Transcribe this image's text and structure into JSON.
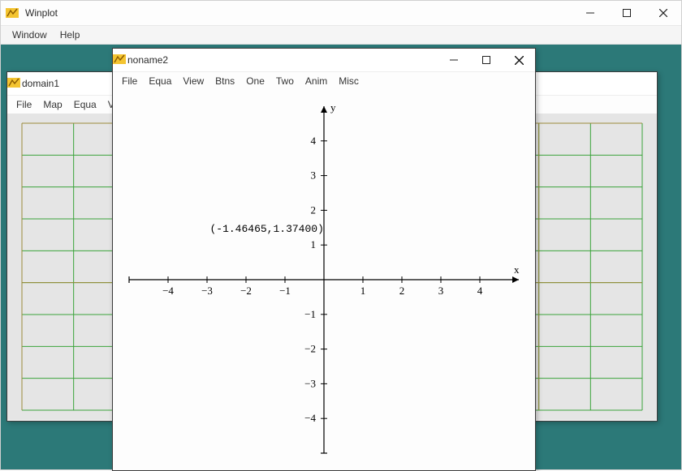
{
  "main": {
    "title": "Winplot",
    "menus": [
      "Window",
      "Help"
    ]
  },
  "domain_window": {
    "title": "domain1",
    "menus": [
      "File",
      "Map",
      "Equa",
      "V"
    ],
    "grid": {
      "nx": 12,
      "ny": 9
    }
  },
  "plot_window": {
    "title": "noname2",
    "menus": [
      "File",
      "Equa",
      "View",
      "Btns",
      "One",
      "Two",
      "Anim",
      "Misc"
    ],
    "x_axis_label": "x",
    "y_axis_label": "y",
    "cursor_readout": "(-1.46465,1.37400)"
  },
  "chart_data": {
    "type": "scatter",
    "title": "",
    "xlabel": "x",
    "ylabel": "y",
    "xlim": [
      -5,
      5
    ],
    "ylim": [
      -5,
      5
    ],
    "x_ticks": [
      -4,
      -3,
      -2,
      -1,
      1,
      2,
      3,
      4
    ],
    "y_ticks": [
      -4,
      -3,
      -2,
      -1,
      1,
      2,
      3,
      4
    ],
    "series": [],
    "cursor_point": {
      "x": -1.46465,
      "y": 1.374
    }
  },
  "colors": {
    "workspace_bg": "#2c7978",
    "grid_green": "#3aa33a",
    "grid_olive": "#9a8a3a",
    "axis": "#000000"
  }
}
